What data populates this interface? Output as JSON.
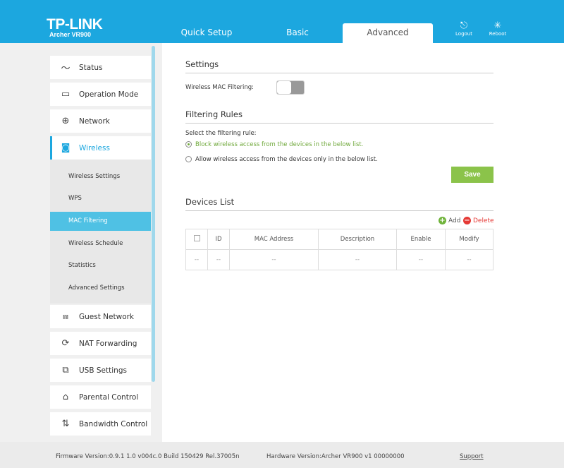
{
  "header": {
    "logo": "TP-LINK",
    "model": "Archer VR900",
    "tabs": [
      "Quick Setup",
      "Basic",
      "Advanced"
    ],
    "active_tab": "Advanced",
    "logout": "Logout",
    "reboot": "Reboot"
  },
  "sidebar": {
    "items": [
      {
        "label": "Status",
        "icon": "status-icon"
      },
      {
        "label": "Operation Mode",
        "icon": "monitor-icon"
      },
      {
        "label": "Network",
        "icon": "globe-icon"
      },
      {
        "label": "Wireless",
        "icon": "wireless-icon"
      },
      {
        "label": "Guest Network",
        "icon": "guest-icon"
      },
      {
        "label": "NAT Forwarding",
        "icon": "nat-icon"
      },
      {
        "label": "USB Settings",
        "icon": "usb-icon"
      },
      {
        "label": "Parental Control",
        "icon": "parental-icon"
      },
      {
        "label": "Bandwidth Control",
        "icon": "bandwidth-icon"
      }
    ],
    "wireless_sub": [
      "Wireless Settings",
      "WPS",
      "MAC Filtering",
      "Wireless Schedule",
      "Statistics",
      "Advanced Settings"
    ],
    "selected_sub": "MAC Filtering"
  },
  "settings": {
    "title": "Settings",
    "mac_filtering_label": "Wireless MAC Filtering:",
    "mac_filtering_on": false
  },
  "rules": {
    "title": "Filtering Rules",
    "prompt": "Select the filtering rule:",
    "options": [
      "Block wireless access from the devices in the below list.",
      "Allow wireless access from the devices only in the below list."
    ],
    "selected": 0,
    "save": "Save"
  },
  "devices": {
    "title": "Devices List",
    "add": "Add",
    "delete": "Delete",
    "columns": [
      "",
      "ID",
      "MAC Address",
      "Description",
      "Enable",
      "Modify"
    ],
    "rows": [
      [
        "--",
        "--",
        "--",
        "--",
        "--",
        "--"
      ]
    ]
  },
  "footer": {
    "firmware": "Firmware Version:0.9.1 1.0 v004c.0 Build 150429 Rel.37005n",
    "hardware": "Hardware Version:Archer VR900 v1 00000000",
    "support": "Support"
  },
  "colors": {
    "header": "#1ca7df",
    "selected_sub": "#4fc1e4",
    "save": "#8bc34a",
    "add": "#6fb33a",
    "delete": "#e53935"
  }
}
